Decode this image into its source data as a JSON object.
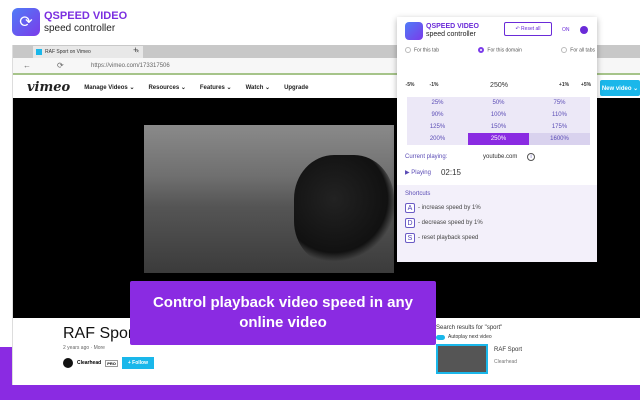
{
  "brand": {
    "name": "QSPEED VIDEO",
    "subtitle": "speed controller"
  },
  "browser": {
    "tab_title": "RAF Sport on Vimeo",
    "url": "https://vimeo.com/173317506"
  },
  "vimeo": {
    "logo": "vimeo",
    "nav": [
      "Manage Videos ⌄",
      "Resources ⌄",
      "Features ⌄",
      "Watch ⌄",
      "Upgrade"
    ],
    "new_video": "New video ⌄",
    "video_title": "RAF Sport",
    "meta": "2 years ago · More",
    "channel": "Clearhead",
    "badge": "PRO",
    "follow": "+ Follow",
    "sidebar": {
      "search": "Search results for \"sport\"",
      "autoplay": "Autoplay next video",
      "item_title": "RAF Sport",
      "item_channel": "Clearhead"
    }
  },
  "caption": "Control playback video speed in any online video",
  "popup": {
    "title": "QSPEED VIDEO",
    "subtitle": "speed controller",
    "reset": "↶ Reset all",
    "toggle": "ON",
    "scopes": [
      "For this tab",
      "For this domain",
      "For all tabs"
    ],
    "selected_scope": "For this domain",
    "steps": [
      "-5%",
      "-1%",
      "250%",
      "+1%",
      "+5%"
    ],
    "presets": [
      "25%",
      "50%",
      "75%",
      "90%",
      "100%",
      "110%",
      "125%",
      "150%",
      "175%",
      "200%",
      "250%",
      "1600%"
    ],
    "selected_preset": "250%",
    "current_label": "Current playing:",
    "current_site": "youtube.com",
    "status": "Playing",
    "time": "02:15",
    "shortcuts_title": "Shortcuts",
    "shortcuts": [
      {
        "key": "A",
        "desc": "- increase speed by 1%"
      },
      {
        "key": "D",
        "desc": "- decrease speed by 1%"
      },
      {
        "key": "S",
        "desc": "- reset playback speed"
      }
    ]
  },
  "accent": "#8a2be2"
}
